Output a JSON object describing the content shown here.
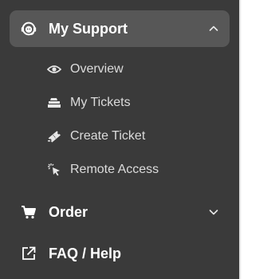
{
  "sidebar": {
    "support": {
      "label": "My Support",
      "icon": "support-agent-icon",
      "expanded": true,
      "items": [
        {
          "label": "Overview",
          "icon": "eye-icon"
        },
        {
          "label": "My Tickets",
          "icon": "ticket-stack-icon"
        },
        {
          "label": "Create Ticket",
          "icon": "create-ticket-icon"
        },
        {
          "label": "Remote Access",
          "icon": "pointer-click-icon"
        }
      ]
    },
    "order": {
      "label": "Order",
      "icon": "cart-icon",
      "expanded": false
    },
    "faq": {
      "label": "FAQ / Help",
      "icon": "external-link-icon"
    }
  },
  "colors": {
    "sidebar_bg": "#3a3a3a",
    "active_bg": "#575757",
    "text": "#ffffff",
    "subtext": "#dcdcdc"
  }
}
